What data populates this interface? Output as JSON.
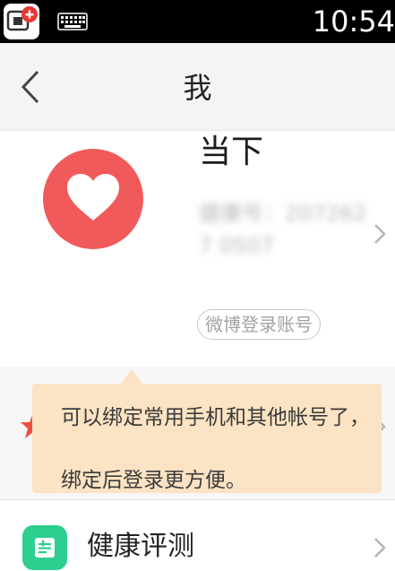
{
  "status_bar": {
    "time": "10:54",
    "icons": [
      "app-notification-icon",
      "keyboard-icon"
    ]
  },
  "header": {
    "title": "我",
    "back_icon": "chevron-left-icon"
  },
  "profile": {
    "username": "当下",
    "account_id": "健康号：2072627 0507",
    "login_badge": "微博登录账号",
    "avatar_icon": "heart-icon",
    "avatar_color": "#f15a5a"
  },
  "bind_tooltip": {
    "line1": "可以绑定常用手机和其他帐号了，",
    "line2": "绑定后登录更方便。",
    "background": "#fbe3c3"
  },
  "menu": {
    "items": [
      {
        "label": "健康评测",
        "icon": "health-assessment-icon",
        "color": "#2ccf8f"
      }
    ]
  }
}
